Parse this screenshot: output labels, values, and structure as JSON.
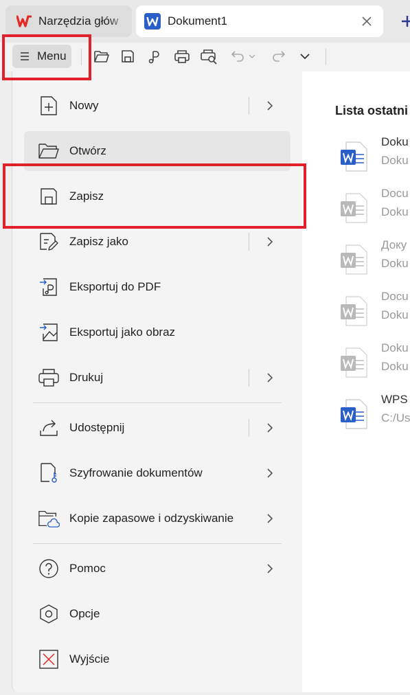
{
  "tabs": {
    "home_label": "Narzędzia głów",
    "doc_label": "Dokument1"
  },
  "toolbar": {
    "menu_label": "Menu"
  },
  "menu": {
    "items": [
      {
        "label": "Nowy",
        "submenu": true
      },
      {
        "label": "Otwórz",
        "submenu": false
      },
      {
        "label": "Zapisz",
        "submenu": false
      },
      {
        "label": "Zapisz jako",
        "submenu": true
      },
      {
        "label": "Eksportuj do PDF",
        "submenu": false
      },
      {
        "label": "Eksportuj jako obraz",
        "submenu": false
      },
      {
        "label": "Drukuj",
        "submenu": true
      },
      {
        "label": "Udostępnij",
        "submenu": true
      },
      {
        "label": "Szyfrowanie dokumentów",
        "submenu": true
      },
      {
        "label": "Kopie zapasowe i odzyskiwanie",
        "submenu": true
      },
      {
        "label": "Pomoc",
        "submenu": true
      },
      {
        "label": "Opcje",
        "submenu": false
      },
      {
        "label": "Wyjście",
        "submenu": false
      }
    ]
  },
  "recent": {
    "title": "Lista ostatni",
    "items": [
      {
        "name": "Doku",
        "path": "Doku",
        "active": true
      },
      {
        "name": "Docu",
        "path": "Doku",
        "active": false
      },
      {
        "name": "Доку",
        "path": "Doku",
        "active": false
      },
      {
        "name": "Docu",
        "path": "Doku",
        "active": false
      },
      {
        "name": "Doku",
        "path": "Doku",
        "active": false
      },
      {
        "name": "WPS",
        "path": "C:/Us",
        "active": true
      }
    ]
  },
  "colors": {
    "accent_word": "#2a5ec9",
    "wps_red": "#e02a26",
    "highlight": "#e0202a"
  }
}
